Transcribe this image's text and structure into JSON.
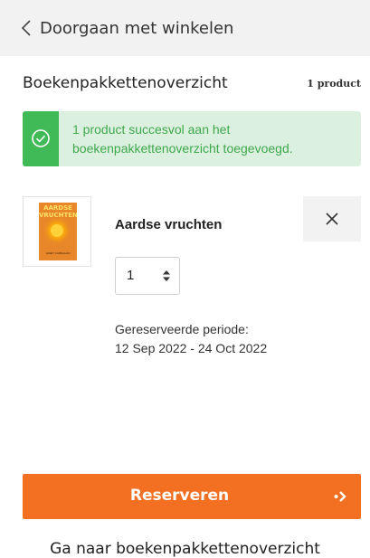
{
  "nav": {
    "back_label": "Doorgaan met winkelen"
  },
  "panel": {
    "title": "Boekenpakkettenoverzicht",
    "count": "1 product"
  },
  "alert": {
    "message": "1 product succesvol aan het boekenpakkettenoverzicht toegevoegd."
  },
  "item": {
    "cover_title": "AARDSE VRUCHTEN",
    "cover_author": "JANET CARNAHAN",
    "title": "Aardse vruchten",
    "quantity": "1",
    "period_label": "Gereserveerde periode:",
    "period_value": "12 Sep 2022 - 24 Oct 2022"
  },
  "actions": {
    "reserve_label": "Reserveren",
    "overview_label": "Ga naar boekenpakkettenoverzicht"
  },
  "colors": {
    "accent": "#f36f22",
    "success": "#3fba56",
    "success_bg": "#dcf0df"
  },
  "icons": {
    "back": "chevron-left-icon",
    "alert": "check-circle-icon",
    "remove": "close-icon",
    "quantity": "sort-arrows-icon",
    "reserve": "arrow-right-icon"
  }
}
